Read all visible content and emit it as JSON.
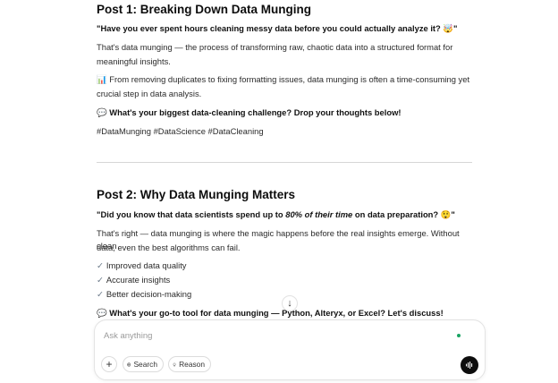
{
  "post1": {
    "title": "Post 1: Breaking Down Data Munging",
    "hook": "\"Have you ever spent hours cleaning messy data before you could actually analyze it? 🤯\"",
    "p1a": "That's data munging — the process of transforming raw, chaotic data into a structured format for",
    "p1b": "meaningful insights.",
    "p2a": "📊 From removing duplicates to fixing formatting issues, data munging is often a time-consuming yet",
    "p2b": "crucial step in data analysis.",
    "question": "💬 What's your biggest data-cleaning challenge? Drop your thoughts below!",
    "hashtags": "#DataMunging #DataScience #DataCleaning"
  },
  "post2": {
    "title": "Post 2: Why Data Munging Matters",
    "hook_pre": "\"Did you know that data scientists spend up to ",
    "hook_em": "80% of their time",
    "hook_post": " on data preparation? 😲\"",
    "p1a": "That's right — data munging is where the magic happens before the real insights emerge. Without clean",
    "p1b": "data, even the best algorithms can fail.",
    "checks": [
      "Improved data quality",
      "Accurate insights",
      "Better decision-making"
    ],
    "question": "💬 What's your go-to tool for data munging — Python, Alteryx, or Excel? Let's discuss!"
  },
  "composer": {
    "placeholder": "Ask anything",
    "plus_label": "+",
    "search_label": "Search",
    "reason_label": "Reason"
  },
  "icons": {
    "check": "✓",
    "down_arrow": "↓"
  }
}
